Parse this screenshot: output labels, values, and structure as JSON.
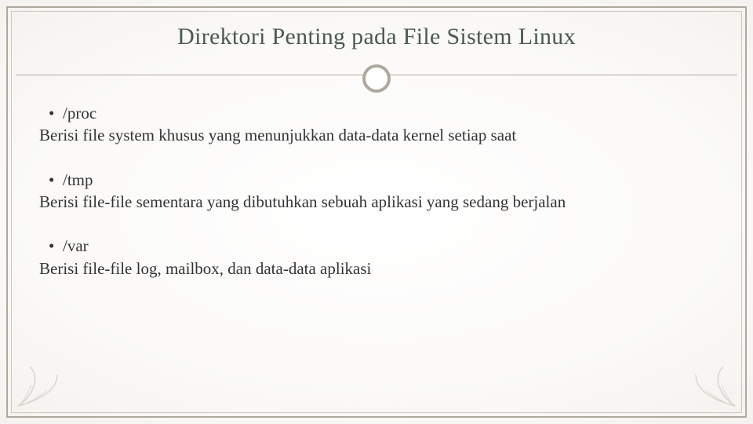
{
  "title": "Direktori Penting pada File Sistem Linux",
  "bullet": "•",
  "items": [
    {
      "dir": "/proc",
      "desc": "Berisi file system khusus yang menunjukkan data-data kernel setiap saat"
    },
    {
      "dir": "/tmp",
      "desc": "Berisi file-file sementara yang dibutuhkan sebuah aplikasi yang sedang berjalan"
    },
    {
      "dir": "/var",
      "desc": "Berisi file-file log, mailbox, dan data-data aplikasi"
    }
  ]
}
